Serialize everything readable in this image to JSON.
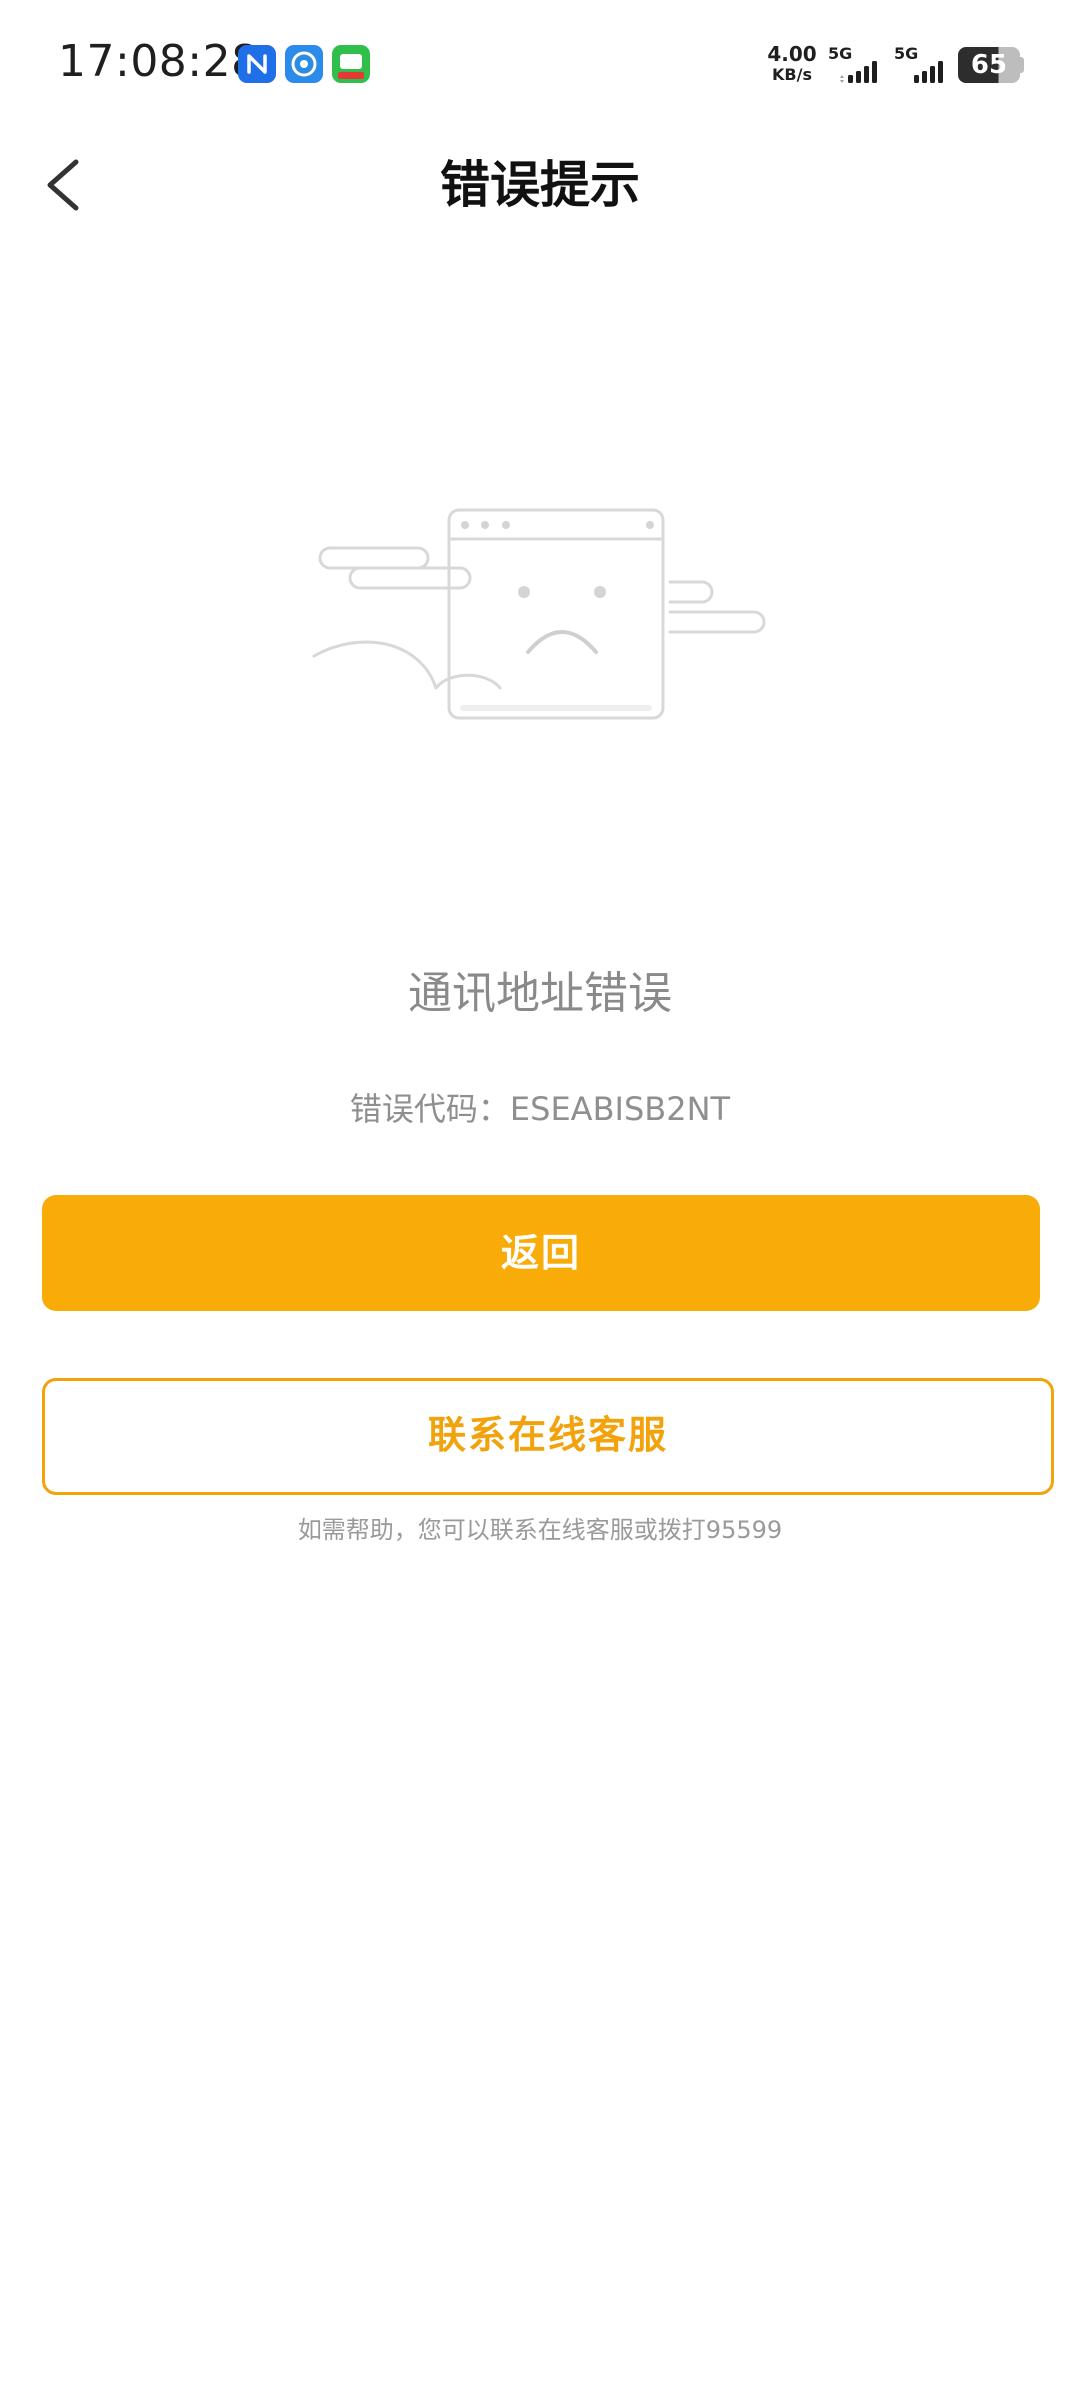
{
  "status_bar": {
    "time": "17:08:28",
    "net_speed_value": "4.00",
    "net_speed_unit": "KB/s",
    "signal_1_label": "5G",
    "signal_2_label": "5G",
    "battery_level": "65",
    "icons": [
      "nfc-icon",
      "app-icon",
      "app-icon"
    ]
  },
  "header": {
    "title": "错误提示",
    "back_icon": "chevron-left-icon"
  },
  "error": {
    "message": "通讯地址错误",
    "code_text": "错误代码：ESEABISB2NT"
  },
  "actions": {
    "primary_label": "返回",
    "secondary_label": "联系在线客服"
  },
  "help": {
    "text": "如需帮助，您可以联系在线客服或拨打95599"
  },
  "colors": {
    "accent": "#f9ab07",
    "outline": "#f2a20b",
    "text_muted": "#8a8a8a"
  }
}
